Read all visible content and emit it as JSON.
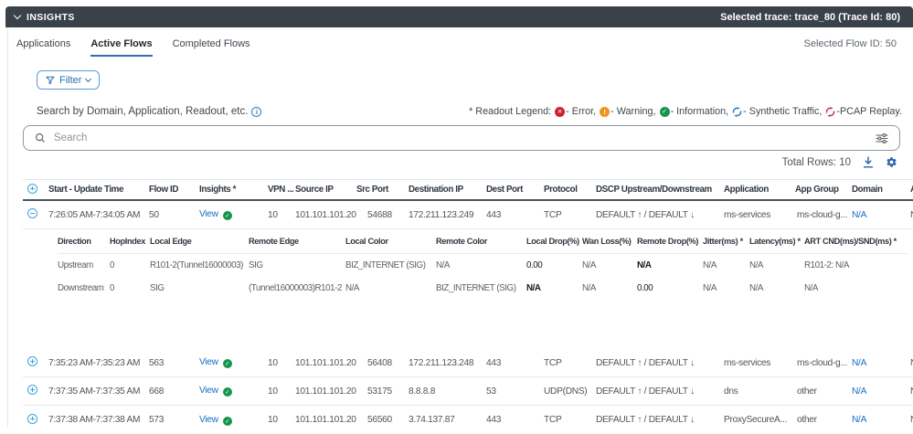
{
  "topbar": {
    "title": "INSIGHTS",
    "selected_trace": "Selected trace: trace_80 (Trace Id: 80)"
  },
  "tabs": {
    "applications": "Applications",
    "active_flows": "Active Flows",
    "completed_flows": "Completed Flows",
    "selected_flow_id": "Selected Flow ID: 50"
  },
  "toolbar": {
    "filter_label": "Filter"
  },
  "search": {
    "hint": "Search by Domain, Application, Readout, etc.",
    "placeholder": "Search"
  },
  "legend": {
    "prefix": "* Readout Legend:",
    "items": [
      {
        "name": "error",
        "label": "- Error,"
      },
      {
        "name": "warning",
        "label": "- Warning,"
      },
      {
        "name": "information",
        "label": "- Information,"
      },
      {
        "name": "synthetic-traffic",
        "label": "- Synthetic Traffic,"
      },
      {
        "name": "pcap-replay",
        "label": "-PCAP Replay."
      }
    ]
  },
  "summary": {
    "total_rows_label": "Total Rows: 10"
  },
  "table": {
    "columns": {
      "time": "Start - Update Time",
      "flow_id": "Flow ID",
      "insights": "Insights *",
      "vpn": "VPN ...",
      "source_ip": "Source IP",
      "src_port": "Src Port",
      "dest_ip": "Destination IP",
      "dest_port": "Dest Port",
      "protocol": "Protocol",
      "dscp": "DSCP Upstream/Downstream",
      "application": "Application",
      "app_group": "App Group",
      "domain": "Domain",
      "clipped": "A"
    },
    "rows": [
      {
        "time": "7:26:05 AM-7:34:05 AM",
        "flow_id": "50",
        "insights_label": "View",
        "vpn": "10",
        "source_ip": "101.101.101.20",
        "src_port": "54688",
        "dest_ip": "172.211.123.249",
        "dest_port": "443",
        "protocol": "TCP",
        "dscp": "DEFAULT ↑ / DEFAULT ↓",
        "application": "ms-services",
        "app_group": "ms-cloud-g...",
        "domain": "N/A",
        "clipped": "N"
      },
      {
        "time": "7:35:23 AM-7:35:23 AM",
        "flow_id": "563",
        "insights_label": "View",
        "vpn": "10",
        "source_ip": "101.101.101.20",
        "src_port": "56408",
        "dest_ip": "172.211.123.248",
        "dest_port": "443",
        "protocol": "TCP",
        "dscp": "DEFAULT ↑ / DEFAULT ↓",
        "application": "ms-services",
        "app_group": "ms-cloud-g...",
        "domain": "N/A",
        "clipped": "N"
      },
      {
        "time": "7:37:35 AM-7:37:35 AM",
        "flow_id": "668",
        "insights_label": "View",
        "vpn": "10",
        "source_ip": "101.101.101.20",
        "src_port": "53175",
        "dest_ip": "8.8.8.8",
        "dest_port": "53",
        "protocol": "UDP(DNS)",
        "dscp": "DEFAULT ↑ / DEFAULT ↓",
        "application": "dns",
        "app_group": "other",
        "domain": "N/A",
        "clipped": "N"
      },
      {
        "time": "7:37:38 AM-7:37:38 AM",
        "flow_id": "573",
        "insights_label": "View",
        "vpn": "10",
        "source_ip": "101.101.101.20",
        "src_port": "56560",
        "dest_ip": "3.74.137.87",
        "dest_port": "443",
        "protocol": "TCP",
        "dscp": "DEFAULT ↑ / DEFAULT ↓",
        "application": "ProxySecureA...",
        "app_group": "other",
        "domain": "N/A",
        "clipped": "N"
      }
    ],
    "expanded": {
      "columns": {
        "direction": "Direction",
        "hop_index": "HopIndex",
        "local_edge": "Local Edge",
        "remote_edge": "Remote Edge",
        "local_color": "Local Color",
        "remote_color": "Remote Color",
        "local_drop": "Local Drop(%)",
        "wan_loss": "Wan Loss(%)",
        "remote_drop": "Remote Drop(%)",
        "jitter": "Jitter(ms) *",
        "latency": "Latency(ms) *",
        "art": "ART CND(ms)/SND(ms) *"
      },
      "rows": [
        {
          "direction": "Upstream",
          "hop_index": "0",
          "local_edge": "R101-2(Tunnel16000003)",
          "remote_edge": "SIG",
          "local_color": "BIZ_INTERNET (SIG)",
          "remote_color": "N/A",
          "local_drop": "0.00",
          "wan_loss": "N/A",
          "remote_drop": "N/A",
          "jitter": "N/A",
          "latency": "N/A",
          "art": "R101-2: N/A"
        },
        {
          "direction": "Downstream",
          "hop_index": "0",
          "local_edge": "SIG",
          "remote_edge": "(Tunnel16000003)R101-2",
          "local_color": "N/A",
          "remote_color": "BIZ_INTERNET (SIG)",
          "local_drop": "N/A",
          "wan_loss": "N/A",
          "remote_drop": "0.00",
          "jitter": "N/A",
          "latency": "N/A",
          "art": "N/A"
        }
      ]
    }
  },
  "colors": {
    "accent_blue": "#1b6ec2",
    "dark_bar": "#3a4149",
    "success_green": "#18944f",
    "error_red": "#d02030",
    "warning_orange": "#ee9420",
    "pcap_red": "#b93e53",
    "expand_icon_blue": "#3ea4da"
  }
}
